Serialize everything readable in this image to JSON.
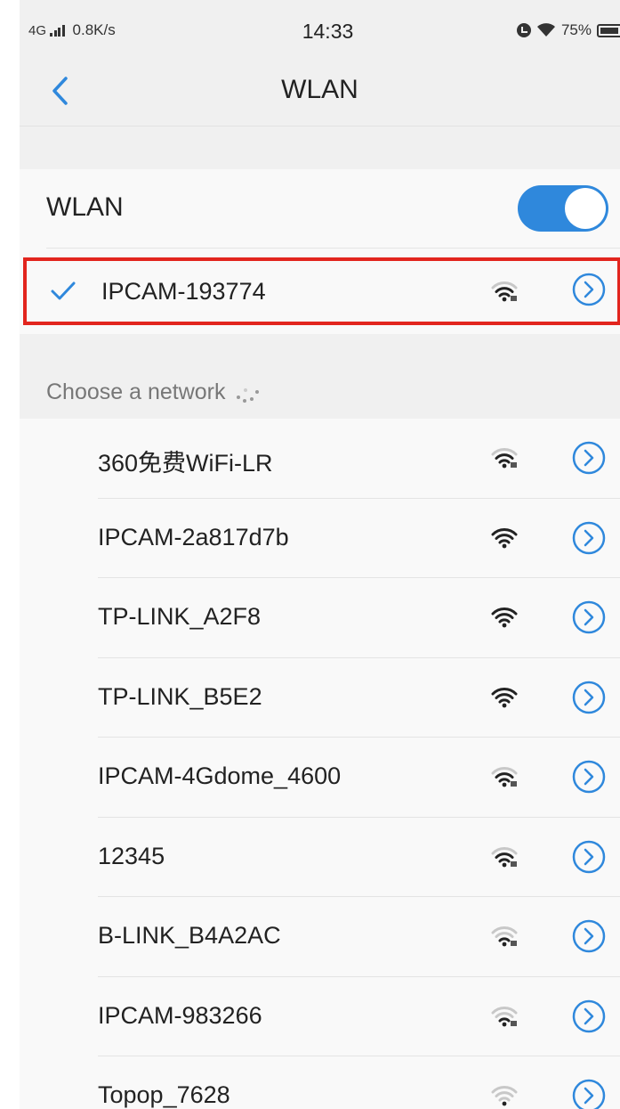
{
  "status_bar": {
    "network": "4G",
    "speed": "0.8K/s",
    "time": "14:33",
    "battery": "75%",
    "battery_level": 0.75,
    "icons": [
      "signal-icon",
      "alarm-icon",
      "wifi-icon",
      "battery-icon"
    ]
  },
  "nav": {
    "title": "WLAN",
    "back_icon": "chevron-left-icon"
  },
  "wlan": {
    "label": "WLAN",
    "enabled": true,
    "connected": {
      "name": "IPCAM-193774",
      "signal": 3,
      "secured": true
    }
  },
  "networks_header": "Choose a network",
  "networks": [
    {
      "name": "360免费WiFi-LR",
      "signal": 3,
      "secured": true
    },
    {
      "name": "IPCAM-2a817d7b",
      "signal": 4,
      "secured": false
    },
    {
      "name": "TP-LINK_A2F8",
      "signal": 4,
      "secured": false
    },
    {
      "name": "TP-LINK_B5E2",
      "signal": 4,
      "secured": false
    },
    {
      "name": "IPCAM-4Gdome_4600",
      "signal": 3,
      "secured": true
    },
    {
      "name": "12345",
      "signal": 3,
      "secured": true
    },
    {
      "name": "B-LINK_B4A2AC",
      "signal": 2,
      "secured": true
    },
    {
      "name": "IPCAM-983266",
      "signal": 2,
      "secured": true
    },
    {
      "name": "Topop_7628",
      "signal": 1,
      "secured": false
    }
  ],
  "colors": {
    "accent": "#2f88dc",
    "highlight_border": "#e2251e",
    "background": "#f0f0f0",
    "card": "#f9f9f9"
  }
}
